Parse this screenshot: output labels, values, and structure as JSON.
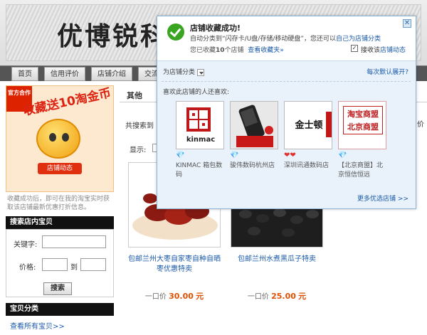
{
  "shop": {
    "title": "优博锐科"
  },
  "nav": {
    "tabs": [
      "首页",
      "信用评价",
      "店铺介绍",
      "交流"
    ]
  },
  "promo": {
    "ribbon": "官方合作",
    "title": "收藏送10淘金币",
    "button": "店铺动态",
    "note": "收藏成功后，即可在我的淘宝实时获取该店铺最新优惠打折信息。"
  },
  "search": {
    "header": "搜索店内宝贝",
    "keyword_label": "关键字:",
    "price_label": "价格:",
    "to_label": "到",
    "button": "搜索"
  },
  "categories": {
    "header": "宝贝分类",
    "link": "查看所有宝贝>>"
  },
  "main": {
    "heading": "其他",
    "found_text": "共搜索到",
    "show_label": "显示:",
    "right_edge": "价",
    "products": [
      {
        "title": "包邮兰州大枣自家枣自种自晒枣优惠特卖",
        "price_label": "一口价",
        "price": "30.00",
        "unit": "元"
      },
      {
        "title": "包邮兰州水煮黑瓜子特卖",
        "price_label": "一口价",
        "price": "25.00",
        "unit": "元"
      }
    ]
  },
  "popup": {
    "title": "店铺收藏成功!",
    "line2_prefix": "自动分类到“闪存卡/U盘/存储/移动硬盘”，您还可以",
    "line2_link": "自己为店铺分类",
    "line3_prefix": "您已收藏",
    "line3_count": "10",
    "line3_mid": "个店铺",
    "line3_link": "查看收藏夹»",
    "notify_prefix": "接收该",
    "notify_link": "店铺动态",
    "notify_checked": "✓",
    "category_label": "为店铺分类",
    "expand_link": "每次默认展开?",
    "also_like": "喜欢此店铺的人还喜欢:",
    "shops": [
      {
        "logo_text": "kinmac",
        "badge": "💎",
        "name": "KINMAC 箱包数码"
      },
      {
        "logo_text": "",
        "badge": "💎",
        "name": "骏伟数码杭州店"
      },
      {
        "logo_text": "金士顿",
        "badge": "❤❤",
        "name": "深圳讯通数码店"
      },
      {
        "logo_text": "淘宝商盟 北京商盟",
        "badge": "💎",
        "name": "【北京商盟】北京恒信恒远"
      }
    ],
    "more_link": "更多优选店铺 >>",
    "close_glyph": "✕"
  },
  "colors": {
    "accent": "#1a5aa8",
    "success": "#3aa520",
    "price": "#e05000"
  }
}
